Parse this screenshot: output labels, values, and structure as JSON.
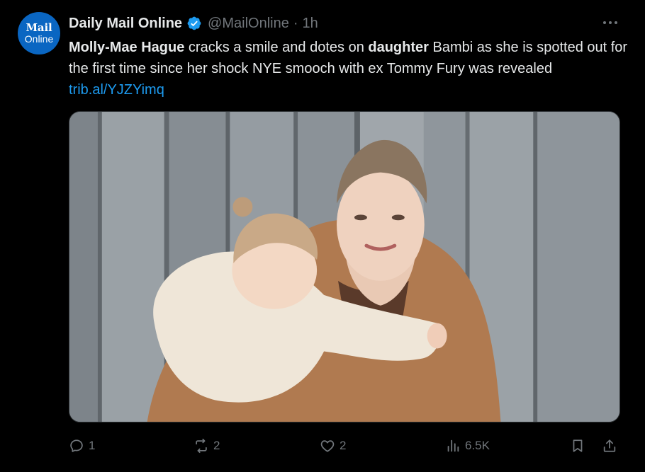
{
  "post": {
    "author": {
      "avatar_text_line1": "Mail",
      "avatar_text_line2": "Online",
      "name": "Daily Mail Online",
      "verified_icon": "verified-badge-icon",
      "handle": "@MailOnline",
      "separator": "·",
      "time": "1h"
    },
    "text": {
      "bold_1": "Molly-Mae Hague",
      "part_1": " cracks a smile and dotes on ",
      "bold_2": "daughter",
      "part_2": " Bambi as she is spotted out for the first time since her shock NYE smooch with ex Tommy Fury was revealed ",
      "link": "trib.al/YJZYimq"
    },
    "actions": {
      "reply_count": "1",
      "repost_count": "2",
      "like_count": "2",
      "views_count": "6.5K"
    },
    "colors": {
      "background": "#000000",
      "text": "#e7e9ea",
      "secondary": "#71767b",
      "link": "#1d9bf0",
      "avatar_bg": "#0a66c2"
    }
  }
}
